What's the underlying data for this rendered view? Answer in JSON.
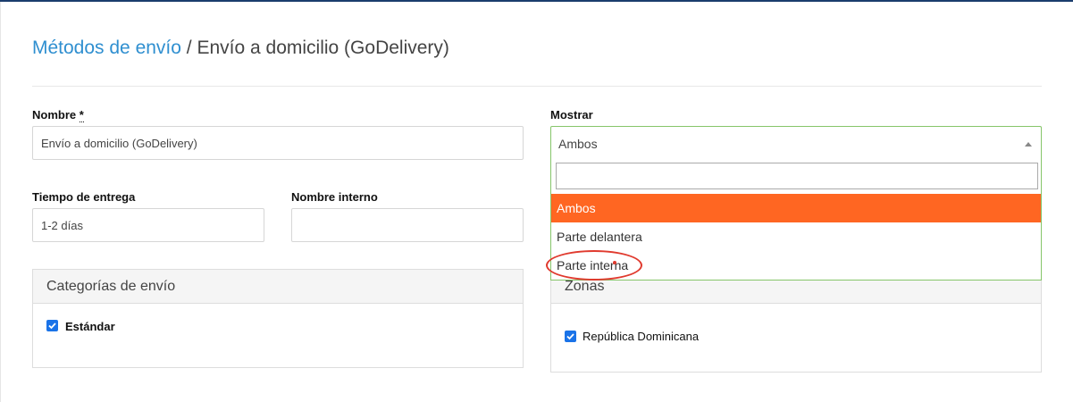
{
  "breadcrumb": {
    "parent": "Métodos de envío",
    "separator": "/",
    "current": "Envío a domicilio (GoDelivery)"
  },
  "form": {
    "nombre": {
      "label": "Nombre",
      "required_mark": "*",
      "value": "Envío a domicilio (GoDelivery)"
    },
    "tiempo_entrega": {
      "label": "Tiempo de entrega",
      "value": "1-2 días"
    },
    "nombre_interno": {
      "label": "Nombre interno",
      "value": ""
    },
    "mostrar": {
      "label": "Mostrar",
      "selected": "Ambos",
      "search_value": "",
      "options": [
        "Ambos",
        "Parte delantera",
        "Parte interna"
      ]
    }
  },
  "categorias": {
    "title": "Categorías de envío",
    "items": [
      {
        "label": "Estándar",
        "checked": true
      }
    ]
  },
  "zonas": {
    "title": "Zonas",
    "items": [
      {
        "label": "República Dominicana",
        "checked": true
      }
    ]
  },
  "colors": {
    "link": "#2f8fd0",
    "highlight": "#ff6622",
    "focus_border": "#86c56a",
    "checkbox": "#1a73e8",
    "annotation": "#e03a2e"
  }
}
